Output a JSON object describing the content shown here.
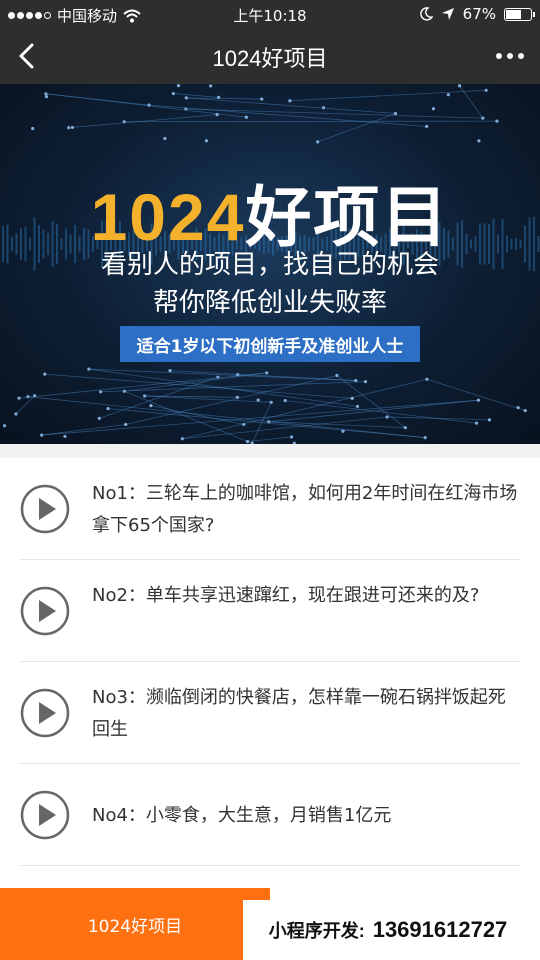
{
  "status_bar": {
    "carrier": "中国移动",
    "time": "上午10:18",
    "battery": "67%",
    "battery_level": 0.67,
    "icons": [
      "signal-icon",
      "wifi-icon",
      "moon-icon",
      "location-arrow-icon",
      "battery-icon"
    ]
  },
  "nav": {
    "title": "1024好项目",
    "icons": [
      "back-icon",
      "more-icon"
    ]
  },
  "banner": {
    "title_num": "1024",
    "title_text": "好项目",
    "line1": "看别人的项目，找自己的机会",
    "line2": "帮你降低创业失败率",
    "tag": "适合1岁以下初创新手及准创业人士",
    "colors": {
      "accent": "#f3b12c",
      "tag_bg": "#2d6fc4"
    }
  },
  "items": [
    {
      "text": "No1：三轮车上的咖啡馆，如何用2年时间在红海市场拿下65个国家?"
    },
    {
      "text": "No2：单车共享迅速蹿红，现在跟进可还来的及?"
    },
    {
      "text": "No3：濒临倒闭的快餐店，怎样靠一碗石锅拌饭起死回生"
    },
    {
      "text": "No4：小零食，大生意，月销售1亿元"
    }
  ],
  "bottom": {
    "tab_label": "1024好项目",
    "promo_label": "小程序开发:",
    "promo_phone": "13691612727",
    "colors": {
      "tab_bg": "#ff7011"
    }
  }
}
